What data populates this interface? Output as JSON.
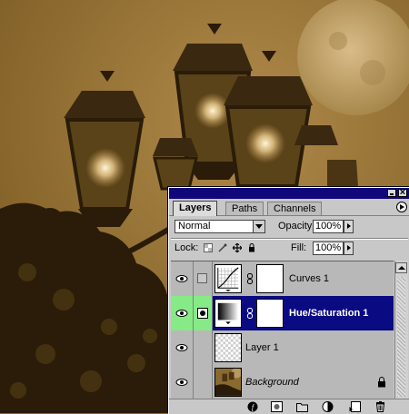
{
  "photo": {
    "description_icon": "street-lamps-photo",
    "tone": "#8a6a2e"
  },
  "palette": {
    "tabs": [
      {
        "label": "Layers",
        "active": true
      },
      {
        "label": "Paths",
        "active": false
      },
      {
        "label": "Channels",
        "active": false
      }
    ],
    "blend_mode": "Normal",
    "opacity_label": "Opacity:",
    "opacity_value": "100%",
    "lock_label": "Lock:",
    "fill_label": "Fill:",
    "fill_value": "100%",
    "layers": [
      {
        "name": "Curves 1",
        "type": "adjustment-curves",
        "visible": true,
        "selected": false
      },
      {
        "name": "Hue/Saturation 1",
        "type": "adjustment-hue",
        "visible": true,
        "selected": true
      },
      {
        "name": "Layer 1",
        "type": "transparent",
        "visible": true,
        "selected": false
      },
      {
        "name": "Background",
        "type": "image",
        "visible": true,
        "selected": false,
        "locked": true
      }
    ],
    "bottom_icons": [
      "layer-style-icon",
      "add-mask-icon",
      "new-set-icon",
      "new-adjustment-icon",
      "new-layer-icon",
      "delete-layer-icon"
    ],
    "colors": {
      "titlebar": "#10087a",
      "selected": "#0a0a82",
      "green": "#86ea86"
    }
  }
}
